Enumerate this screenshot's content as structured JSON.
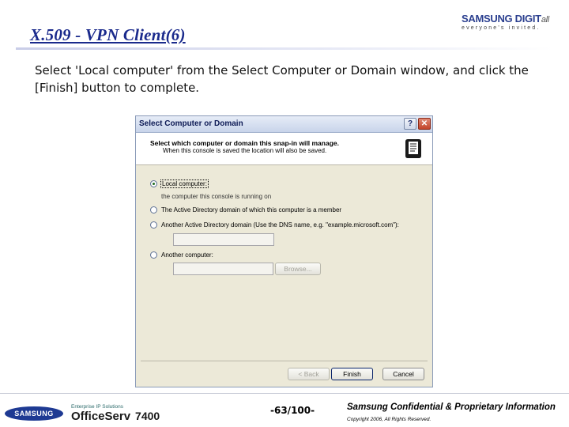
{
  "slide": {
    "title": "X.509 - VPN Client(6)",
    "instruction": "Select 'Local computer' from the Select Computer or Domain window, and click the [Finish] button to complete."
  },
  "brand": {
    "name": "SAMSUNG DIGIT",
    "suffix": "all",
    "tagline": "everyone's invited."
  },
  "dialog": {
    "title": "Select Computer or Domain",
    "header_main": "Select which computer or domain this snap-in will manage.",
    "header_sub": "When this console is saved the location will also be saved.",
    "options": [
      {
        "label": "Local computer:",
        "selected": true
      },
      {
        "label": "The Active Directory domain of which this computer is a member",
        "selected": false
      },
      {
        "label": "Another Active Directory domain (Use the DNS name, e.g. \"example.microsoft.com\"):",
        "selected": false
      },
      {
        "label": "Another computer:",
        "selected": false
      }
    ],
    "local_desc": "the computer this console is running on",
    "browse_label": "Browse...",
    "back_label": "< Back",
    "finish_label": "Finish",
    "cancel_label": "Cancel",
    "help_label": "?",
    "close_label": "✕"
  },
  "footer": {
    "logo_text": "SAMSUNG",
    "tagline": "Enterprise IP Solutions",
    "product_a": "Office",
    "product_b": "Serv",
    "product_num": "7400",
    "page": "-63/100-",
    "confidential": "Samsung Confidential & Proprietary Information",
    "copyright": "Copyright 2006, All Rights Reserved."
  },
  "colors": {
    "title": "#1a2a8c",
    "titlebar": "#c8d4ea",
    "dialog_bg": "#ece9d8",
    "close_button": "#c2442a"
  },
  "icons": {
    "header": "certificate-scroll-icon"
  }
}
